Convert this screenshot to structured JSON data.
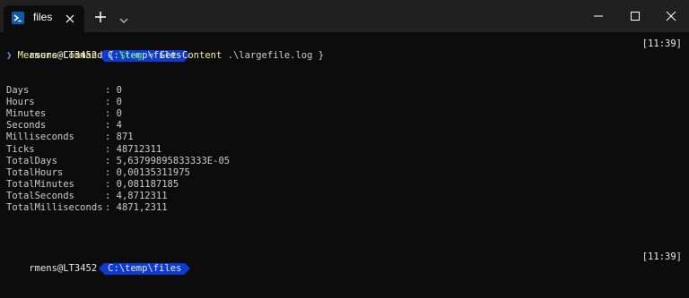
{
  "window": {
    "tab_title": "files",
    "new_tab_symbol": "+",
    "colors": {
      "titlebar": "#202020",
      "background": "#0c0c0c",
      "prompt_path_bg": "#0d3bd1"
    }
  },
  "prompt": {
    "user_host": "rmens@LT3452",
    "path_1": "C:\\temp\\files",
    "time_1": "[11:39]",
    "path_2": "C:\\temp\\files",
    "time_2": "[11:39]",
    "chevron": "❯"
  },
  "command": {
    "cmdlet": "Measure-Command",
    "open_brace": "{",
    "variable": "$log",
    "equals": "=",
    "inner_cmdlet": "Get-Content",
    "argument": ".\\largefile.log",
    "close_brace": "}"
  },
  "output": [
    {
      "name": "Days",
      "value": "0"
    },
    {
      "name": "Hours",
      "value": "0"
    },
    {
      "name": "Minutes",
      "value": "0"
    },
    {
      "name": "Seconds",
      "value": "4"
    },
    {
      "name": "Milliseconds",
      "value": "871"
    },
    {
      "name": "Ticks",
      "value": "48712311"
    },
    {
      "name": "TotalDays",
      "value": "5,63799895833333E-05"
    },
    {
      "name": "TotalHours",
      "value": "0,00135311975"
    },
    {
      "name": "TotalMinutes",
      "value": "0,081187185"
    },
    {
      "name": "TotalSeconds",
      "value": "4,8712311"
    },
    {
      "name": "TotalMilliseconds",
      "value": "4871,2311"
    }
  ]
}
